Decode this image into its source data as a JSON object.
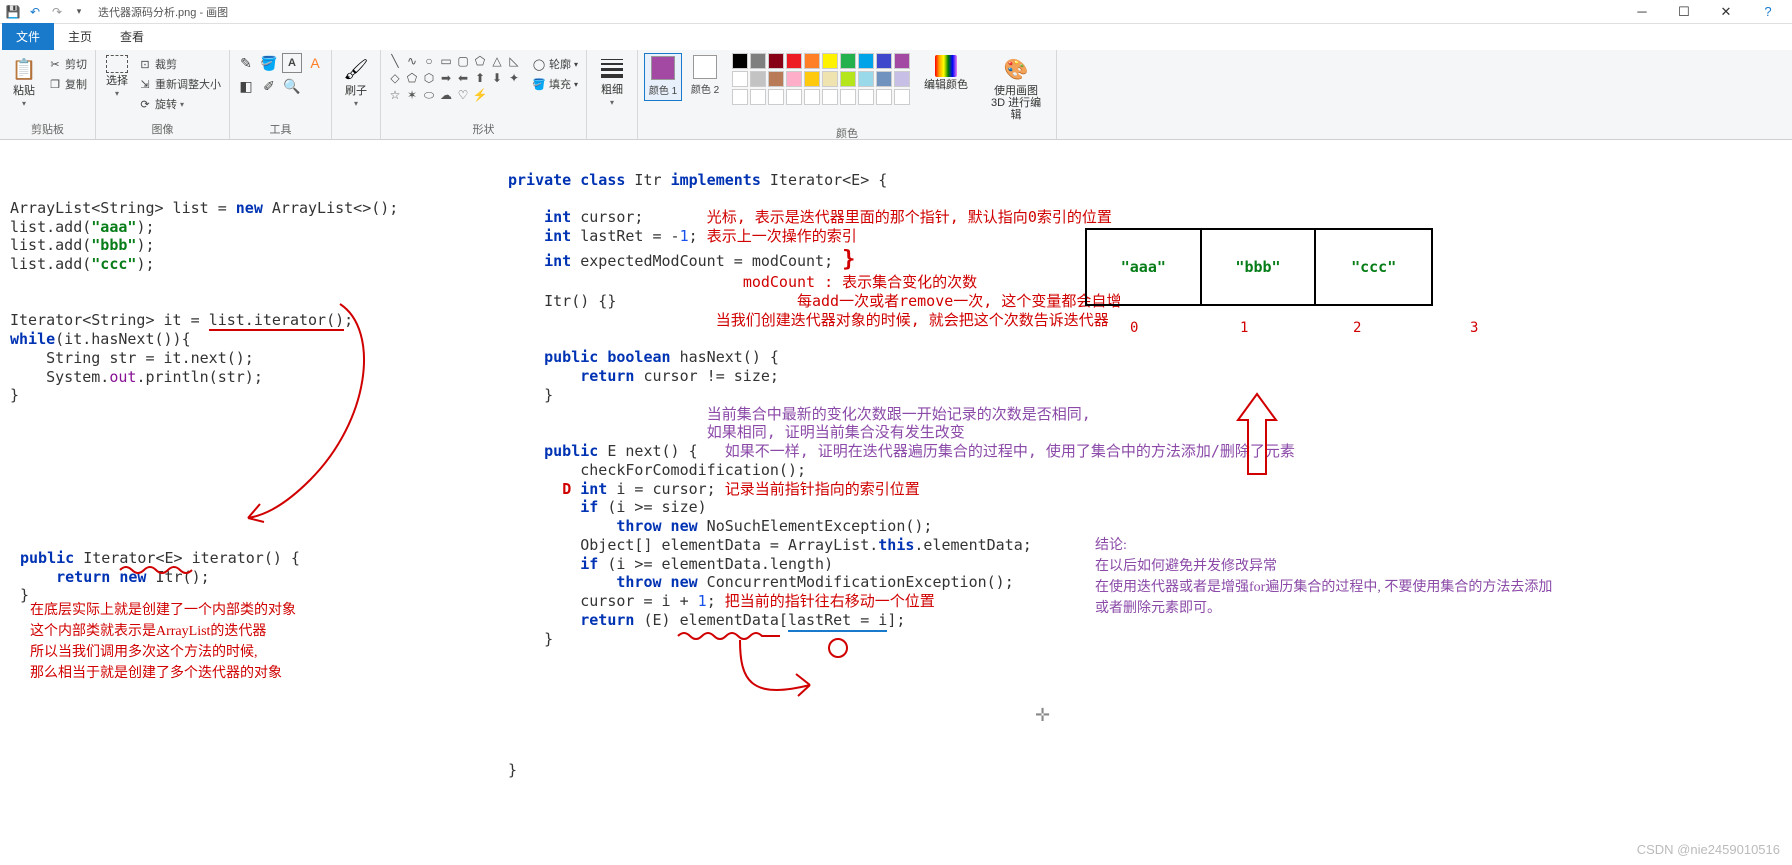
{
  "title": "迭代器源码分析.png - 画图",
  "tabs": {
    "file": "文件",
    "home": "主页",
    "view": "查看"
  },
  "ribbon": {
    "clipboard": {
      "paste": "粘贴",
      "cut": "剪切",
      "copy": "复制",
      "label": "剪贴板"
    },
    "image": {
      "select": "选择",
      "crop": "裁剪",
      "resize": "重新调整大小",
      "rotate": "旋转",
      "label": "图像"
    },
    "tools": {
      "label": "工具"
    },
    "brush": {
      "btn": "刷子",
      "label": ""
    },
    "shapes": {
      "outline": "轮廓",
      "fill": "填充",
      "label": "形状"
    },
    "size": {
      "btn": "粗细",
      "label": ""
    },
    "color1": {
      "label": "颜色 1"
    },
    "color2": {
      "label": "颜色 2"
    },
    "editcolors": {
      "label": "编辑颜色"
    },
    "paint3d": {
      "label": "使用画图 3D 进行编辑"
    },
    "colors_label": "颜色"
  },
  "palette_row1": [
    "#000000",
    "#7f7f7f",
    "#880015",
    "#ed1c24",
    "#ff7f27",
    "#fff200",
    "#22b14c",
    "#00a2e8",
    "#3f48cc",
    "#a349a4"
  ],
  "palette_row2": [
    "#ffffff",
    "#c3c3c3",
    "#b97a57",
    "#ffaec9",
    "#ffc90e",
    "#efe4b0",
    "#b5e61d",
    "#99d9ea",
    "#7092be",
    "#c8bfe7"
  ],
  "palette_row3": [
    "#ffffff",
    "#ffffff",
    "#ffffff",
    "#ffffff",
    "#ffffff",
    "#ffffff",
    "#ffffff",
    "#ffffff",
    "#ffffff",
    "#ffffff"
  ],
  "selected_color": "#a349a4",
  "code_left": {
    "l1": "ArrayList<String> list = new ArrayList<>();",
    "l2": "list.add(\"aaa\");",
    "l3": "list.add(\"bbb\");",
    "l4": "list.add(\"ccc\");",
    "l5": "Iterator<String> it = list.iterator();",
    "l6": "while(it.hasNext()){",
    "l7": "    String str = it.next();",
    "l8": "    System.out.println(str);",
    "l9": "}",
    "iter1": "public Iterator<E> iterator() {",
    "iter2": "    return new Itr();",
    "iter3": "}"
  },
  "note_left": {
    "n1": "在底层实际上就是创建了一个内部类的对象",
    "n2": "这个内部类就表示是ArrayList的迭代器",
    "n3": "所以当我们调用多次这个方法的时候,",
    "n4": "那么相当于就是创建了多个迭代器的对象"
  },
  "code_right": {
    "r1": "private class Itr implements Iterator<E> {",
    "r2": "    int cursor;",
    "r2c": "光标, 表示是迭代器里面的那个指针, 默认指向0索引的位置",
    "r3": "    int lastRet = -1;",
    "r3c": "表示上一次操作的索引",
    "r4": "    int expectedModCount = modCount;",
    "r4c1": "modCount : 表示集合变化的次数",
    "r4c2": "每add一次或者remove一次, 这个变量都会自增",
    "r4c3": "当我们创建迭代器对象的时候, 就会把这个次数告诉迭代器",
    "r5": "    Itr() {}",
    "r6": "    public boolean hasNext() {",
    "r7": "        return cursor != size;",
    "r8": "    }",
    "nc1": "当前集合中最新的变化次数跟一开始记录的次数是否相同,",
    "nc2": "如果相同, 证明当前集合没有发生改变",
    "nc3": "如果不一样, 证明在迭代器遍历集合的过程中, 使用了集合中的方法添加/删除了元素",
    "r9": "    public E next() {",
    "r10": "        checkForComodification();",
    "r11": "        int i = cursor;",
    "r11c": "记录当前指针指向的索引位置",
    "r12": "        if (i >= size)",
    "r13": "            throw new NoSuchElementException();",
    "r14": "        Object[] elementData = ArrayList.this.elementData;",
    "r15": "        if (i >= elementData.length)",
    "r16": "            throw new ConcurrentModificationException();",
    "r17": "        cursor = i + 1;",
    "r17c": "把当前的指针往右移动一个位置",
    "r18": "        return (E) elementData[lastRet = i];",
    "r19": "    }",
    "r20": "}"
  },
  "array": {
    "a": "\"aaa\"",
    "b": "\"bbb\"",
    "c": "\"ccc\"",
    "i0": "0",
    "i1": "1",
    "i2": "2",
    "i3": "3"
  },
  "conclusion": {
    "t": "结论:",
    "c1": "在以后如何避免并发修改异常",
    "c2": "在使用迭代器或者是增强for遍历集合的过程中, 不要使用集合的方法去添加或者删除元素即可。"
  },
  "watermark": "CSDN @nie2459010516"
}
